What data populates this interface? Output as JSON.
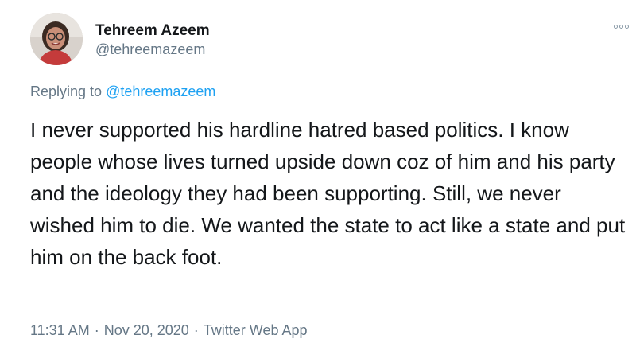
{
  "author": {
    "name": "Tehreem Azeem",
    "handle": "@tehreemazeem"
  },
  "reply": {
    "prefix": "Replying to ",
    "handle": "@tehreemazeem"
  },
  "tweet": {
    "text": "I never supported his hardline hatred based politics. I know people whose lives turned upside down coz of him and his party and the ideology they had been supporting. Still, we never wished him to die. We wanted the state to act like a state and put him on the back foot."
  },
  "meta": {
    "time": "11:31 AM",
    "separator": "·",
    "date": "Nov 20, 2020",
    "source": "Twitter Web App"
  },
  "icons": {
    "more": "more-options-icon",
    "avatar": "profile-avatar"
  },
  "colors": {
    "text": "#14171a",
    "muted": "#657786",
    "link": "#1da1f2"
  }
}
